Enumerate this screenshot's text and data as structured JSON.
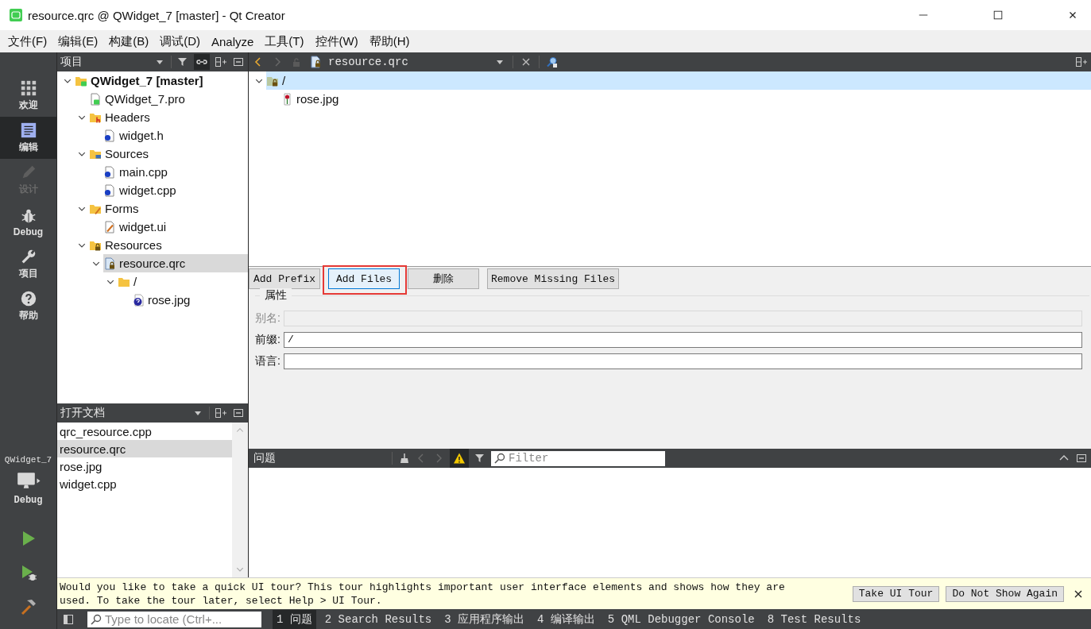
{
  "window": {
    "title": "resource.qrc @ QWidget_7 [master] - Qt Creator"
  },
  "menu": [
    "文件(F)",
    "编辑(E)",
    "构建(B)",
    "调试(D)",
    "Analyze",
    "工具(T)",
    "控件(W)",
    "帮助(H)"
  ],
  "modes": [
    {
      "label": "欢迎",
      "kind": "welcome",
      "selected": false,
      "disabled": false
    },
    {
      "label": "编辑",
      "kind": "edit",
      "selected": true,
      "disabled": false
    },
    {
      "label": "设计",
      "kind": "design",
      "selected": false,
      "disabled": true
    },
    {
      "label": "Debug",
      "kind": "debug",
      "selected": false,
      "disabled": false
    },
    {
      "label": "项目",
      "kind": "projects",
      "selected": false,
      "disabled": false
    },
    {
      "label": "帮助",
      "kind": "help",
      "selected": false,
      "disabled": false
    }
  ],
  "kit": {
    "project": "QWidget_7",
    "build": "Debug"
  },
  "project_panel": {
    "title": "项目",
    "tree": [
      {
        "label": "QWidget_7 [master]",
        "kind": "project",
        "expanded": true,
        "selected": false,
        "children": [
          {
            "label": "QWidget_7.pro",
            "kind": "pro",
            "selected": false
          },
          {
            "label": "Headers",
            "kind": "folder-h",
            "expanded": true,
            "selected": false,
            "children": [
              {
                "label": "widget.h",
                "kind": "code",
                "selected": false
              }
            ]
          },
          {
            "label": "Sources",
            "kind": "folder-cpp",
            "expanded": true,
            "selected": false,
            "children": [
              {
                "label": "main.cpp",
                "kind": "code",
                "selected": false
              },
              {
                "label": "widget.cpp",
                "kind": "code",
                "selected": false
              }
            ]
          },
          {
            "label": "Forms",
            "kind": "folder-ui",
            "expanded": true,
            "selected": false,
            "children": [
              {
                "label": "widget.ui",
                "kind": "form",
                "selected": false
              }
            ]
          },
          {
            "label": "Resources",
            "kind": "folder-qrc",
            "expanded": true,
            "selected": false,
            "children": [
              {
                "label": "resource.qrc",
                "kind": "qrc",
                "expanded": true,
                "selected": true,
                "children": [
                  {
                    "label": "/",
                    "kind": "folder",
                    "expanded": true,
                    "selected": false,
                    "children": [
                      {
                        "label": "rose.jpg",
                        "kind": "image",
                        "selected": false
                      }
                    ]
                  }
                ]
              }
            ]
          }
        ]
      }
    ]
  },
  "open_documents": {
    "title": "打开文档",
    "items": [
      {
        "label": "qrc_resource.cpp",
        "selected": false
      },
      {
        "label": "resource.qrc",
        "selected": true
      },
      {
        "label": "rose.jpg",
        "selected": false
      },
      {
        "label": "widget.cpp",
        "selected": false
      }
    ]
  },
  "editor": {
    "file": "resource.qrc",
    "tree": [
      {
        "label": "/",
        "kind": "prefix",
        "expanded": true,
        "selected": true,
        "children": [
          {
            "label": "rose.jpg",
            "kind": "rose",
            "selected": false
          }
        ]
      }
    ],
    "buttons": [
      {
        "label": "Add Prefix",
        "focused": false,
        "annotated": false
      },
      {
        "label": "Add Files",
        "focused": true,
        "annotated": true
      },
      {
        "label": "删除",
        "focused": false,
        "annotated": false
      },
      {
        "label": "Remove Missing Files",
        "focused": false,
        "annotated": false
      }
    ],
    "properties": {
      "title": "属性",
      "fields": [
        {
          "label": "别名:",
          "disabled": true
        },
        {
          "label": "前缀:",
          "value": "/",
          "disabled": false
        },
        {
          "label": "语言:",
          "disabled": false
        }
      ]
    }
  },
  "issues": {
    "title": "问题",
    "filter_placeholder": "Filter"
  },
  "tour": {
    "message": "Would you like to take a quick UI tour? This tour highlights important user interface elements and shows how they are used. To take the tour later, select Help > UI Tour.",
    "buttons": [
      "Take UI Tour",
      "Do Not Show Again"
    ]
  },
  "status_bar": {
    "locate_placeholder": "Type to locate (Ctrl+...",
    "tabs": [
      {
        "label": "1 问题",
        "selected": true
      },
      {
        "label": "2 Search Results",
        "selected": false
      },
      {
        "label": "3 应用程序输出",
        "selected": false
      },
      {
        "label": "4 编译输出",
        "selected": false
      },
      {
        "label": "5 QML Debugger Console",
        "selected": false
      },
      {
        "label": "8 Test Results",
        "selected": false
      }
    ]
  }
}
